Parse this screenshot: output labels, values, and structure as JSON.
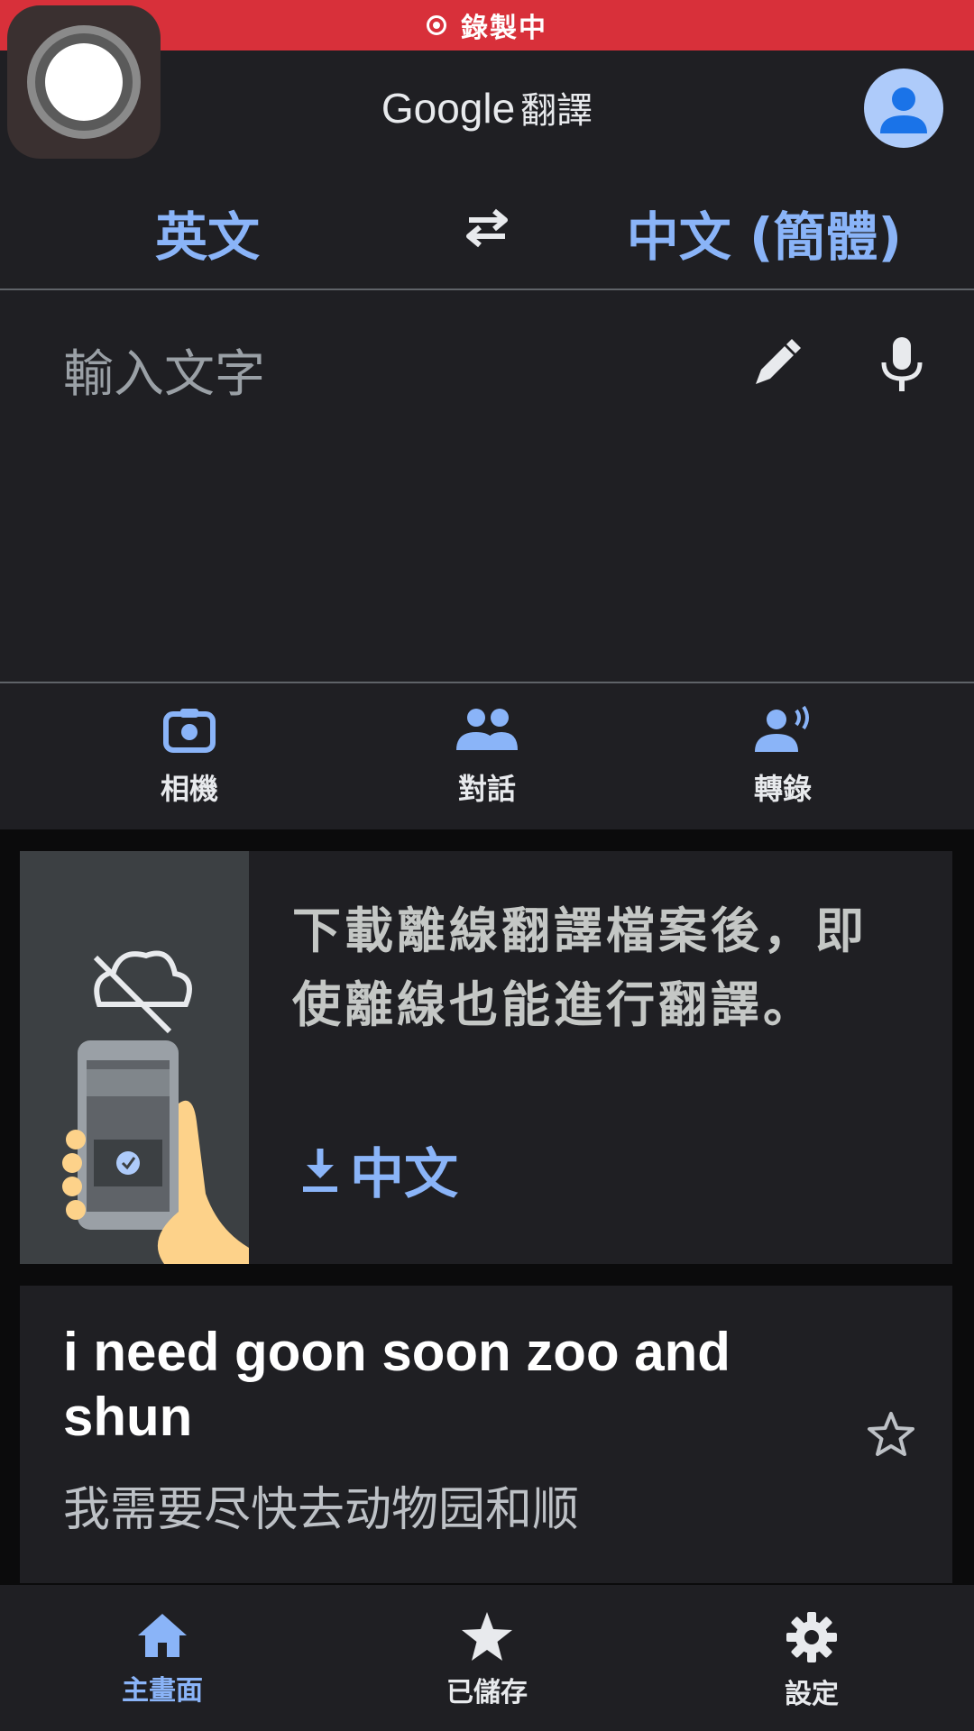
{
  "status_bar": {
    "recording_label": "錄製中"
  },
  "header": {
    "brand": "Google",
    "product": "翻譯"
  },
  "languages": {
    "source": "英文",
    "target": "中文 (簡體)"
  },
  "input": {
    "placeholder": "輸入文字"
  },
  "tools": [
    {
      "label": "相機",
      "icon": "camera-icon"
    },
    {
      "label": "對話",
      "icon": "people-icon"
    },
    {
      "label": "轉錄",
      "icon": "transcribe-icon"
    }
  ],
  "offline_card": {
    "message": "下載離線翻譯檔案後，即使離線也能進行翻譯。",
    "download_label": "中文"
  },
  "history": [
    {
      "source": "i need goon soon zoo and shun",
      "translation": "我需要尽快去动物园和顺"
    }
  ],
  "bottom_nav": [
    {
      "label": "主畫面",
      "icon": "home-icon",
      "active": true
    },
    {
      "label": "已儲存",
      "icon": "star-icon",
      "active": false
    },
    {
      "label": "設定",
      "icon": "gear-icon",
      "active": false
    }
  ],
  "colors": {
    "accent": "#8ab4f8",
    "recording_bar": "#d8303a",
    "surface": "#1f1f23",
    "background": "#0b0b0c"
  }
}
